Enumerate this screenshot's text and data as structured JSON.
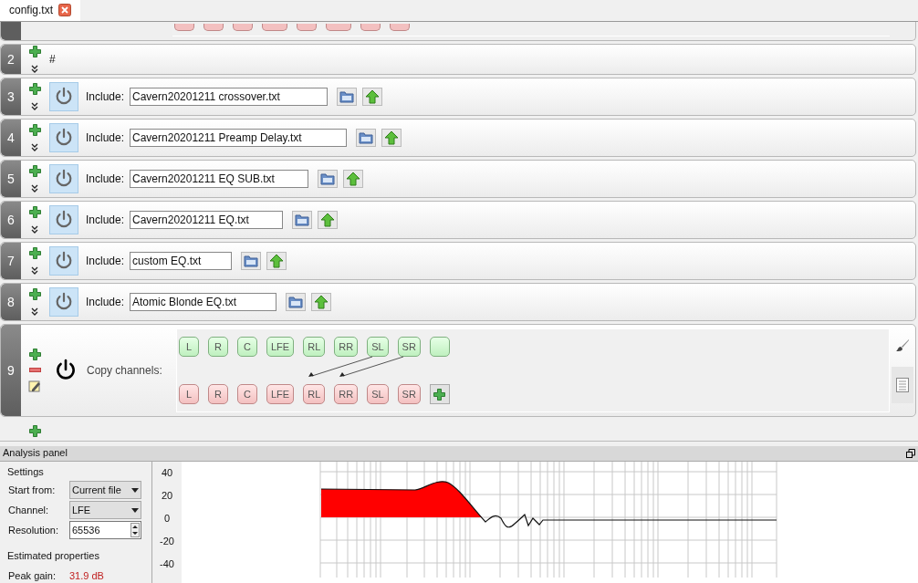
{
  "tabs": [
    {
      "label": "config.txt",
      "selected": true
    }
  ],
  "rows": [
    {
      "number": "2",
      "kind": "comment",
      "text": "#"
    },
    {
      "number": "3",
      "kind": "include",
      "label": "Include:",
      "file": "Cavern20201211 crossover.txt"
    },
    {
      "number": "4",
      "kind": "include",
      "label": "Include:",
      "file": "Cavern20201211 Preamp Delay.txt"
    },
    {
      "number": "5",
      "kind": "include",
      "label": "Include:",
      "file": "Cavern20201211 EQ SUB.txt"
    },
    {
      "number": "6",
      "kind": "include",
      "label": "Include:",
      "file": "Cavern20201211 EQ.txt"
    },
    {
      "number": "7",
      "kind": "include",
      "label": "Include:",
      "file": "custom EQ.txt"
    },
    {
      "number": "8",
      "kind": "include",
      "label": "Include:",
      "file": "Atomic Blonde EQ.txt"
    },
    {
      "number": "9",
      "kind": "copy",
      "label": "Copy channels:",
      "sources": [
        "L",
        "R",
        "C",
        "LFE",
        "RL",
        "RR",
        "SL",
        "SR"
      ],
      "targets": [
        "L",
        "R",
        "C",
        "LFE",
        "RL",
        "RR",
        "SL",
        "SR"
      ]
    }
  ],
  "analysis": {
    "title": "Analysis panel",
    "settings": {
      "title": "Settings",
      "start_from": {
        "label": "Start from:",
        "value": "Current file"
      },
      "channel": {
        "label": "Channel:",
        "value": "LFE"
      },
      "resolution": {
        "label": "Resolution:",
        "value": "65536"
      }
    },
    "estimated": {
      "title": "Estimated properties",
      "peak_gain": {
        "label": "Peak gain:",
        "value": "31.9 dB"
      }
    },
    "graph": {
      "y_labels": [
        "40",
        "20",
        "0",
        "-20",
        "-40"
      ]
    }
  }
}
